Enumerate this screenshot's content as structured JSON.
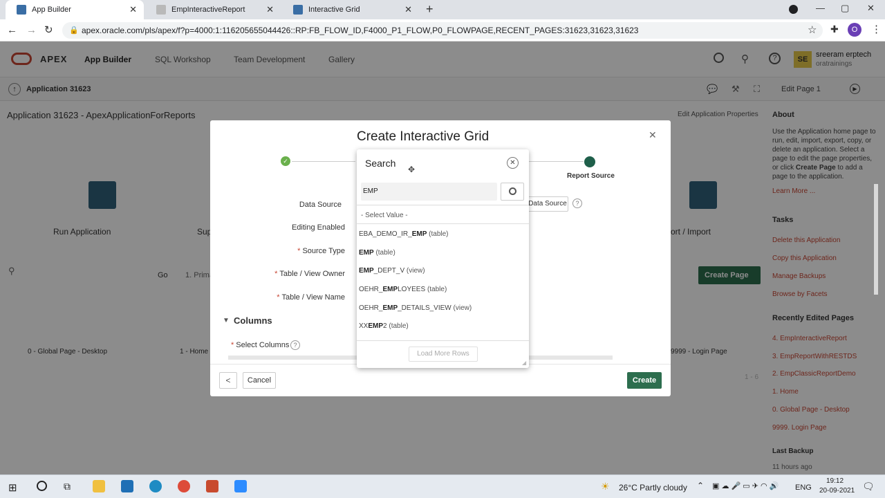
{
  "browser": {
    "tabs": [
      {
        "label": "App Builder",
        "active": true
      },
      {
        "label": "EmpInteractiveReport",
        "active": false
      },
      {
        "label": "Interactive Grid",
        "active": false
      }
    ],
    "new_tab": "+",
    "url": "apex.oracle.com/pls/apex/f?p=4000:1:116205655044426::RP:FB_FLOW_ID,F4000_P1_FLOW,P0_FLOWPAGE,RECENT_PAGES:31623,31623,31623",
    "profile_initial": "O"
  },
  "apex_header": {
    "logo": "APEX",
    "nav": [
      "App Builder",
      "SQL Workshop",
      "Team Development",
      "Gallery"
    ],
    "user_initials": "SE",
    "user_name": "sreeram erptech",
    "user_workspace": "oratrainings"
  },
  "subbar": {
    "app_label": "Application 31623",
    "edit_page": "Edit Page 1"
  },
  "page": {
    "title": "Application 31623 - ApexApplicationForReports",
    "edit_props": "Edit Application Properties",
    "tiles": [
      "Run Application",
      "Sup",
      "ort / Import"
    ],
    "go": "Go",
    "primary": "1. Prima",
    "create_page": "Create Page",
    "page_tiles": [
      "0 - Global Page - Desktop",
      "1 - Home",
      "9999 - Login Page"
    ],
    "count": "1 - 6",
    "sidebar": {
      "about_title": "About",
      "about_text_1": "Use the Application home page to run, edit, import, export, copy, or delete an application. Select a page to edit the page properties, or click ",
      "about_bold": "Create Page",
      "about_text_2": " to add a page to the application.",
      "learn_more": "Learn More ...",
      "tasks_title": "Tasks",
      "tasks": [
        "Delete this Application",
        "Copy this Application",
        "Manage Backups",
        "Browse by Facets"
      ],
      "recent_title": "Recently Edited Pages",
      "recent": [
        "4. EmpInteractiveReport",
        "3. EmpReportWithRESTDS",
        "2. EmpClassicReportDemo",
        "1. Home",
        "0. Global Page - Desktop",
        "9999. Login Page"
      ],
      "backup_title": "Last Backup",
      "backup_time": "11 hours ago"
    }
  },
  "modal": {
    "title": "Create Interactive Grid",
    "step_label": "Report Source",
    "fields": {
      "data_source": "Data Source",
      "editing_enabled": "Editing Enabled",
      "source_type": "Source Type",
      "table_owner": "Table / View Owner",
      "table_name": "Table / View Name"
    },
    "data_source_btn": "Data Source",
    "columns_heading": "Columns",
    "select_columns": "Select Columns",
    "back": "<",
    "cancel": "Cancel",
    "create": "Create"
  },
  "search_popup": {
    "title": "Search",
    "query": "EMP",
    "placeholder_option": "- Select Value -",
    "options": [
      {
        "pre": "EBA_DEMO_IR_",
        "match": "EMP",
        "post": "",
        "kind": "(table)"
      },
      {
        "pre": "",
        "match": "EMP",
        "post": "",
        "kind": "(table)"
      },
      {
        "pre": "",
        "match": "EMP",
        "post": "_DEPT_V",
        "kind": "(view)"
      },
      {
        "pre": "OEHR_",
        "match": "EMP",
        "post": "LOYEES",
        "kind": "(table)"
      },
      {
        "pre": "OEHR_",
        "match": "EMP",
        "post": "_DETAILS_VIEW",
        "kind": "(view)"
      },
      {
        "pre": "XX",
        "match": "EMP",
        "post": "2",
        "kind": "(table)"
      }
    ],
    "load_more": "Load More Rows"
  },
  "taskbar": {
    "weather": "26°C  Partly cloudy",
    "lang": "ENG",
    "time": "19:12",
    "date": "20-09-2021"
  },
  "colors": {
    "apex_red": "#c74634",
    "create_green": "#2d6e4e",
    "step_green": "#1f5f4a",
    "check_green": "#6ab04c"
  }
}
